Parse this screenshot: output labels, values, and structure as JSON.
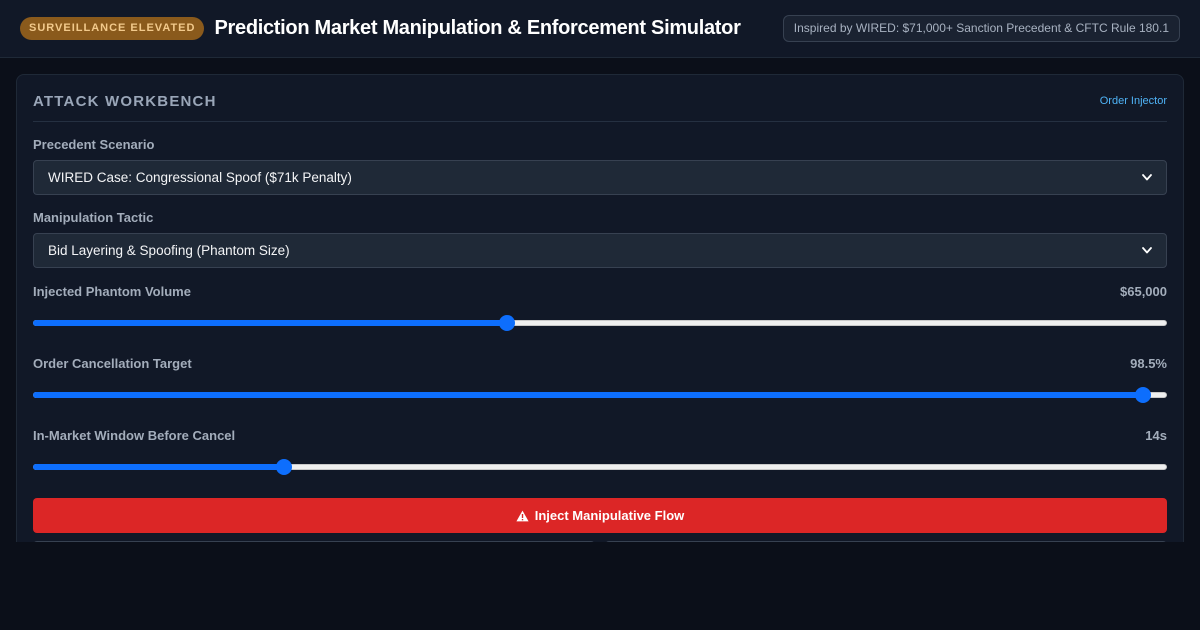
{
  "header": {
    "badge": "SURVEILLANCE ELEVATED",
    "title": "Prediction Market Manipulation & Enforcement Simulator",
    "source": "Inspired by WIRED: $71,000+ Sanction Precedent & CFTC Rule 180.1"
  },
  "workbench": {
    "title": "ATTACK WORKBENCH",
    "link": "Order Injector",
    "scenario": {
      "label": "Precedent Scenario",
      "selected": "WIRED Case: Congressional Spoof ($71k Penalty)"
    },
    "tactic": {
      "label": "Manipulation Tactic",
      "selected": "Bid Layering & Spoofing (Phantom Size)"
    },
    "sliders": [
      {
        "label": "Injected Phantom Volume",
        "value": "$65,000",
        "fraction": 0.417
      },
      {
        "label": "Order Cancellation Target",
        "value": "98.5%",
        "fraction": 0.986
      },
      {
        "label": "In-Market Window Before Cancel",
        "value": "14s",
        "fraction": 0.217
      }
    ],
    "inject_button": "Inject Manipulative Flow"
  },
  "colors": {
    "accent": "#0d6efd",
    "danger": "#dc2626",
    "badge_bg": "#8a5a1c",
    "link": "#4fb3f6"
  },
  "icons": {
    "select_caret": "chevron-down-icon",
    "button_icon": "warning-icon"
  }
}
